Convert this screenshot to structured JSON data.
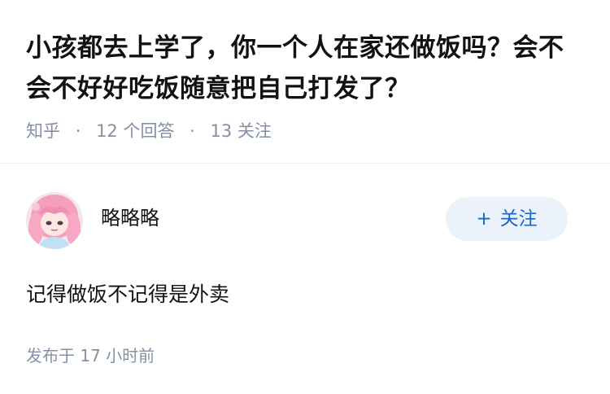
{
  "question": {
    "title": "小孩都去上学了，你一个人在家还做饭吗？会不会不好好吃饭随意把自己打发了？",
    "source": "知乎",
    "separator": "·",
    "answers_count": "12 个回答",
    "followers_count": "13 关注"
  },
  "answer": {
    "author_name": "略略略",
    "avatar_icon": "anime-girl-avatar-icon",
    "follow_plus": "+",
    "follow_label": "关注",
    "content": "记得做饭不记得是外卖",
    "published_time": "发布于 17 小时前"
  },
  "colors": {
    "title": "#121212",
    "meta": "#8590a6",
    "accent": "#1967c6",
    "follow_bg": "#ebf2fa",
    "divider": "#f0f2f7"
  }
}
